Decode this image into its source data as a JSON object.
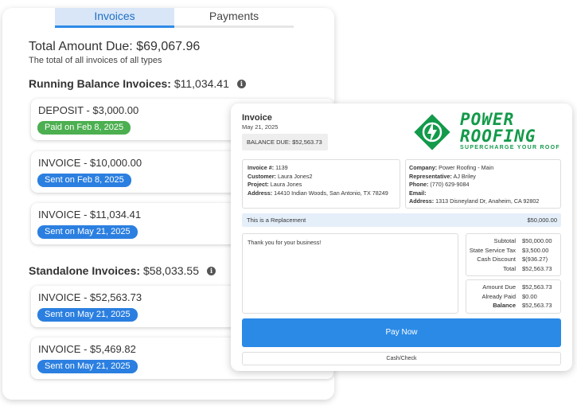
{
  "tabs": [
    {
      "label": "Invoices",
      "active": true
    },
    {
      "label": "Payments",
      "active": false
    }
  ],
  "summary": {
    "total_label": "Total Amount Due:",
    "total_value": "$69,067.96",
    "total_sub": "The total of all invoices of all types"
  },
  "running": {
    "label": "Running Balance Invoices:",
    "value": "$11,034.41",
    "items": [
      {
        "title": "DEPOSIT - $3,000.00",
        "status": "Paid on Feb 8, 2025",
        "status_color": "#4caf50"
      },
      {
        "title": "INVOICE - $10,000.00",
        "status": "Sent on Feb 8, 2025",
        "status_color": "#2b7fe0"
      },
      {
        "title": "INVOICE - $11,034.41",
        "status": "Sent on May 21, 2025",
        "status_color": "#2b7fe0"
      }
    ]
  },
  "standalone": {
    "label": "Standalone Invoices:",
    "value": "$58,033.55",
    "items": [
      {
        "title": "INVOICE - $52,563.73",
        "status": "Sent on May 21, 2025",
        "status_color": "#2b7fe0"
      },
      {
        "title": "INVOICE - $5,469.82",
        "status": "Sent on May 21, 2025",
        "status_color": "#2b7fe0"
      }
    ]
  },
  "invoice": {
    "title": "Invoice",
    "date": "May 21, 2025",
    "balance_due": "BALANCE DUE: $52,563.73",
    "logo": {
      "line1": "POWER",
      "line2": "ROOFING",
      "tagline": "SUPERCHARGE YOUR ROOF",
      "color": "#139a4a",
      "icon": "lightning-bolt-icon"
    },
    "left_info": [
      {
        "k": "Invoice #:",
        "v": "1139"
      },
      {
        "k": "Customer:",
        "v": "Laura Jones2"
      },
      {
        "k": "Project:",
        "v": "Laura Jones"
      },
      {
        "k": "Address:",
        "v": "14410 Indian Woods, San Antonio, TX 78249"
      }
    ],
    "right_info": [
      {
        "k": "Company:",
        "v": "Power Roofing - Main"
      },
      {
        "k": "Representative:",
        "v": "AJ Briley"
      },
      {
        "k": "Phone:",
        "v": "(770) 629-9084"
      },
      {
        "k": "Email:",
        "v": ""
      },
      {
        "k": "Address:",
        "v": "1313 Disneyland Dr, Anaheim, CA 92802"
      }
    ],
    "line_item": {
      "label": "This is a Replacement",
      "amount": "$50,000.00"
    },
    "note": "Thank you for your business!",
    "totals": [
      {
        "k": "Subtotal",
        "v": "$50,000.00"
      },
      {
        "k": "State Service Tax",
        "v": "$3,500.00"
      },
      {
        "k": "Cash Discount",
        "v": "$(936.27)"
      },
      {
        "k": "Total",
        "v": "$52,563.73"
      }
    ],
    "amounts": [
      {
        "k": "Amount Due",
        "v": "$52,563.73"
      },
      {
        "k": "Already Paid",
        "v": "$0.00"
      },
      {
        "k": "Balance",
        "v": "$52,563.73",
        "bold": true
      }
    ],
    "pay_label": "Pay Now",
    "cash_label": "Cash/Check",
    "accent": "#2b8ae6"
  }
}
